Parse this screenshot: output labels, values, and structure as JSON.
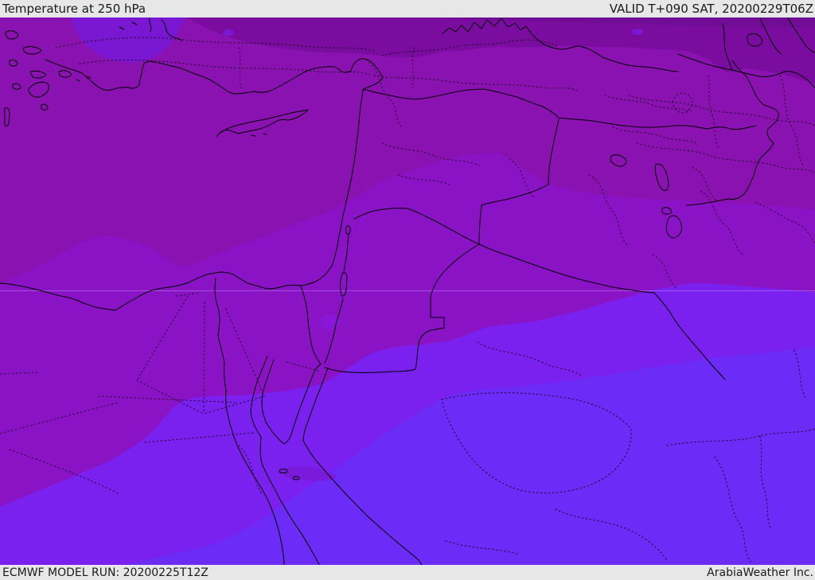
{
  "header": {
    "title": "Temperature at 250 hPa",
    "valid_label": "VALID T+090 SAT, 20200229T06Z"
  },
  "footer": {
    "model_run": "ECMWF MODEL RUN: 20200225T12Z",
    "credit": "ArabiaWeather Inc."
  },
  "map": {
    "kind": "filled-contour temperature field with coastlines and borders",
    "bands": [
      {
        "id": "band-top-edge-darkest",
        "color": "#700C95"
      },
      {
        "id": "band-dark-purple-north",
        "color": "#7A0CA0"
      },
      {
        "id": "band-medium-purple",
        "color": "#8A12B1"
      },
      {
        "id": "band-vivid-purple",
        "color": "#8B13C6"
      },
      {
        "id": "band-violet-south",
        "color": "#7B21EF"
      },
      {
        "id": "band-blue-violet-southeast",
        "color": "#6C2BF7"
      },
      {
        "id": "pocket-violet-anatolia",
        "color": "#7A17D2"
      },
      {
        "id": "pocket-violet-aqaba",
        "color": "#8A17D8"
      },
      {
        "id": "pocket-violet-red-sea",
        "color": "#7A1BDB"
      }
    ],
    "line_color": "#000000",
    "gridline_color": "#D0B0FF",
    "bar_background": "#E7E7E7",
    "text_color": "#1A1A1A"
  }
}
